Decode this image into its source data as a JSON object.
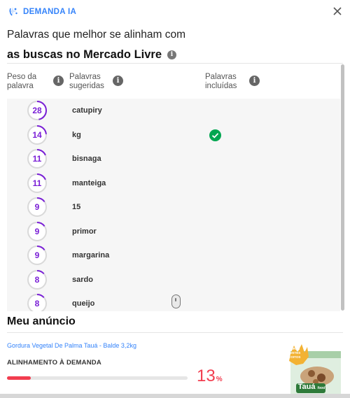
{
  "header": {
    "brand_label": "DEMANDA IA",
    "close_icon": "close-icon"
  },
  "title": {
    "line1": "Palavras que melhor se alinham com",
    "line2": "as buscas no Mercado Livre"
  },
  "columns": {
    "peso": "Peso da palavra",
    "sugeridas": "Palavras sugeridas",
    "incluidas": "Palavras incluídas"
  },
  "keywords": [
    {
      "weight": "28",
      "word": "catupiry",
      "included": false
    },
    {
      "weight": "14",
      "word": "kg",
      "included": true
    },
    {
      "weight": "11",
      "word": "bisnaga",
      "included": false
    },
    {
      "weight": "11",
      "word": "manteiga",
      "included": false
    },
    {
      "weight": "9",
      "word": "15",
      "included": false
    },
    {
      "weight": "9",
      "word": "primor",
      "included": false
    },
    {
      "weight": "9",
      "word": "margarina",
      "included": false
    },
    {
      "weight": "8",
      "word": "sardo",
      "included": false
    },
    {
      "weight": "8",
      "word": "queijo",
      "included": false
    }
  ],
  "listing": {
    "section_title": "Meu anúncio",
    "product_title": "Gordura Vegetal De Palma Tauá - Balde 3,2kg",
    "alignment_label": "ALINHAMENTO À DEMANDA",
    "alignment_value": "13",
    "alignment_unit": "%",
    "alignment_fraction": 0.13,
    "product_image": {
      "brand": "Tauá",
      "brand_sub": "food",
      "badge_lines": [
        "FRITURAS",
        "SORVETES",
        "BISCOITOS"
      ]
    }
  },
  "colors": {
    "accent_purple": "#7a1fd6",
    "link_blue": "#3483fa",
    "alert_red": "#f23d4f",
    "success_green": "#00a650"
  }
}
